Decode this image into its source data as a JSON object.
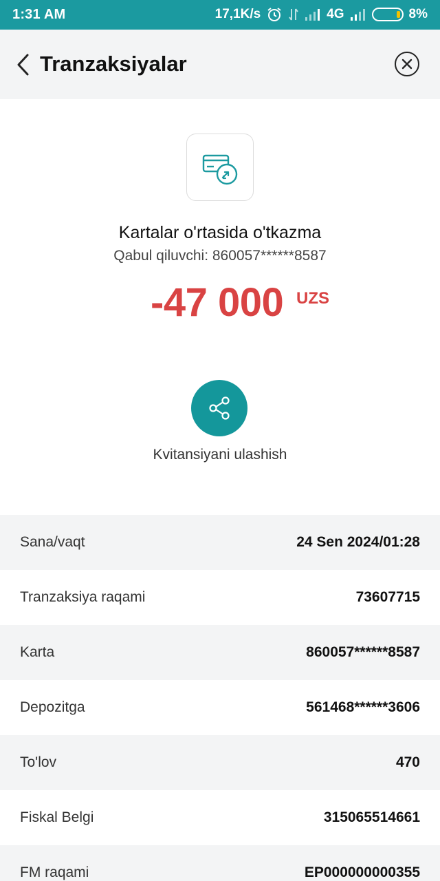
{
  "status_bar": {
    "time": "1:31 AM",
    "speed": "17,1K/s",
    "network": "4G",
    "battery": "8%",
    "icons": [
      "alarm-icon",
      "data-transfer-icon",
      "signal-icon",
      "signal-icon",
      "battery-icon"
    ]
  },
  "header": {
    "title": "Tranzaksiyalar",
    "back_icon": "chevron-left-icon",
    "close_icon": "close-circle-icon"
  },
  "transaction": {
    "icon": "card-transfer-icon",
    "title": "Kartalar o'rtasida o'tkazma",
    "recipient": "Qabul qiluvchi: 860057******8587",
    "amount": "-47 000",
    "currency": "UZS"
  },
  "share": {
    "icon": "share-icon",
    "label": "Kvitansiyani ulashish"
  },
  "details": [
    {
      "label": "Sana/vaqt",
      "value": "24 Sen 2024/01:28"
    },
    {
      "label": "Tranzaksiya raqami",
      "value": "73607715"
    },
    {
      "label": "Karta",
      "value": "860057******8587"
    },
    {
      "label": "Depozitga",
      "value": "561468******3606"
    },
    {
      "label": "To'lov",
      "value": "470"
    },
    {
      "label": "Fiskal Belgi",
      "value": "315065514661"
    },
    {
      "label": "FM raqami",
      "value": "EP000000000355"
    }
  ],
  "colors": {
    "status_bar": "#1b9aa0",
    "accent": "#14979b",
    "amount": "#d94343",
    "row_alt": "#f3f4f5"
  }
}
